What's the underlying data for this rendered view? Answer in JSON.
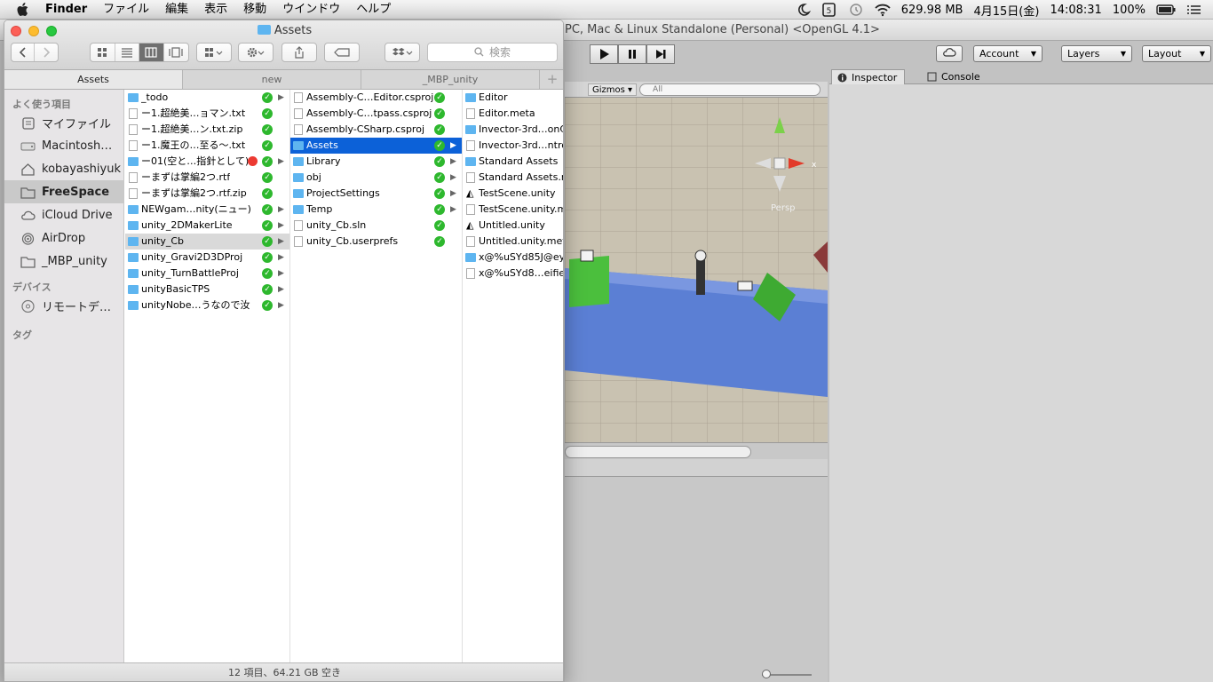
{
  "menubar": {
    "app": "Finder",
    "items": [
      "ファイル",
      "編集",
      "表示",
      "移動",
      "ウインドウ",
      "ヘルプ"
    ],
    "memory": "629.98 MB",
    "date": "4月15日(金)",
    "time": "14:08:31",
    "battery": "100%"
  },
  "unity": {
    "title": "PC, Mac & Linux Standalone (Personal) <OpenGL 4.1>",
    "account": "Account",
    "layers": "Layers",
    "layout": "Layout",
    "gizmos": "Gizmos",
    "scene_search_placeholder": "All",
    "inspector_tab": "Inspector",
    "console_tab": "Console",
    "persp_label": "Persp",
    "axis_x": "x",
    "axis_y": "y"
  },
  "finder": {
    "title": "Assets",
    "search_placeholder": "検索",
    "tabs": [
      "Assets",
      "new",
      "_MBP_unity"
    ],
    "sidebar": {
      "favorites_header": "よく使う項目",
      "favorites": [
        {
          "label": "マイファイル",
          "icon": "all-files-icon"
        },
        {
          "label": "Macintosh…",
          "icon": "hard-drive-icon"
        },
        {
          "label": "kobayashiyuk",
          "icon": "home-icon"
        },
        {
          "label": "FreeSpace",
          "icon": "folder-icon"
        },
        {
          "label": "iCloud Drive",
          "icon": "cloud-icon"
        },
        {
          "label": "AirDrop",
          "icon": "airdrop-icon"
        },
        {
          "label": "_MBP_unity",
          "icon": "folder-icon"
        }
      ],
      "devices_header": "デバイス",
      "devices": [
        {
          "label": "リモートデ…",
          "icon": "disc-icon"
        }
      ],
      "tags_header": "タグ"
    },
    "column1": [
      {
        "name": "_todo",
        "kind": "folder",
        "arrow": true
      },
      {
        "name": "ー1.超絶美…ョマン.txt",
        "kind": "file"
      },
      {
        "name": "ー1.超絶美…ン.txt.zip",
        "kind": "file"
      },
      {
        "name": "ー1.魔王の…至る〜.txt",
        "kind": "file"
      },
      {
        "name": "ー01(空と…指針として)",
        "kind": "folder",
        "arrow": true,
        "red_tag": true
      },
      {
        "name": "ーまずは掌編2つ.rtf",
        "kind": "file"
      },
      {
        "name": "ーまずは掌編2つ.rtf.zip",
        "kind": "file"
      },
      {
        "name": "NEWgam…nity(ニュー)",
        "kind": "folder",
        "arrow": true
      },
      {
        "name": "unity_2DMakerLite",
        "kind": "folder",
        "arrow": true
      },
      {
        "name": "unity_Cb",
        "kind": "folder",
        "arrow": true,
        "gray": true
      },
      {
        "name": "unity_Gravi2D3DProj",
        "kind": "folder",
        "arrow": true
      },
      {
        "name": "unity_TurnBattleProj",
        "kind": "folder",
        "arrow": true
      },
      {
        "name": "unityBasicTPS",
        "kind": "folder",
        "arrow": true
      },
      {
        "name": "unityNobe…うなので汝",
        "kind": "folder",
        "arrow": true
      }
    ],
    "column2": [
      {
        "name": "Assembly-C…Editor.csproj",
        "kind": "file"
      },
      {
        "name": "Assembly-C…tpass.csproj",
        "kind": "file"
      },
      {
        "name": "Assembly-CSharp.csproj",
        "kind": "file"
      },
      {
        "name": "Assets",
        "kind": "folder",
        "arrow": true,
        "selected": true
      },
      {
        "name": "Library",
        "kind": "folder",
        "arrow": true
      },
      {
        "name": "obj",
        "kind": "folder",
        "arrow": true
      },
      {
        "name": "ProjectSettings",
        "kind": "folder",
        "arrow": true
      },
      {
        "name": "Temp",
        "kind": "folder",
        "arrow": true
      },
      {
        "name": "unity_Cb.sln",
        "kind": "file"
      },
      {
        "name": "unity_Cb.userprefs",
        "kind": "file"
      }
    ],
    "column3": [
      {
        "name": "Editor",
        "kind": "folder"
      },
      {
        "name": "Editor.meta",
        "kind": "file"
      },
      {
        "name": "Invector-3rd…onC",
        "kind": "folder"
      },
      {
        "name": "Invector-3rd…ntro",
        "kind": "file"
      },
      {
        "name": "Standard Assets",
        "kind": "folder"
      },
      {
        "name": "Standard Assets.m",
        "kind": "file"
      },
      {
        "name": "TestScene.unity",
        "kind": "unity"
      },
      {
        "name": "TestScene.unity.m",
        "kind": "file"
      },
      {
        "name": "Untitled.unity",
        "kind": "unity"
      },
      {
        "name": "Untitled.unity.meta",
        "kind": "file"
      },
      {
        "name": "x@%uSYd85J@ey",
        "kind": "folder"
      },
      {
        "name": "x@%uSYd8…eifie",
        "kind": "file"
      }
    ],
    "status": "12 項目、64.21 GB 空き"
  },
  "colors": {
    "selection": "#0c61d8",
    "sync_check": "#2eb82e",
    "red_tag": "#ec3a32",
    "folder": "#5eb5f0"
  }
}
